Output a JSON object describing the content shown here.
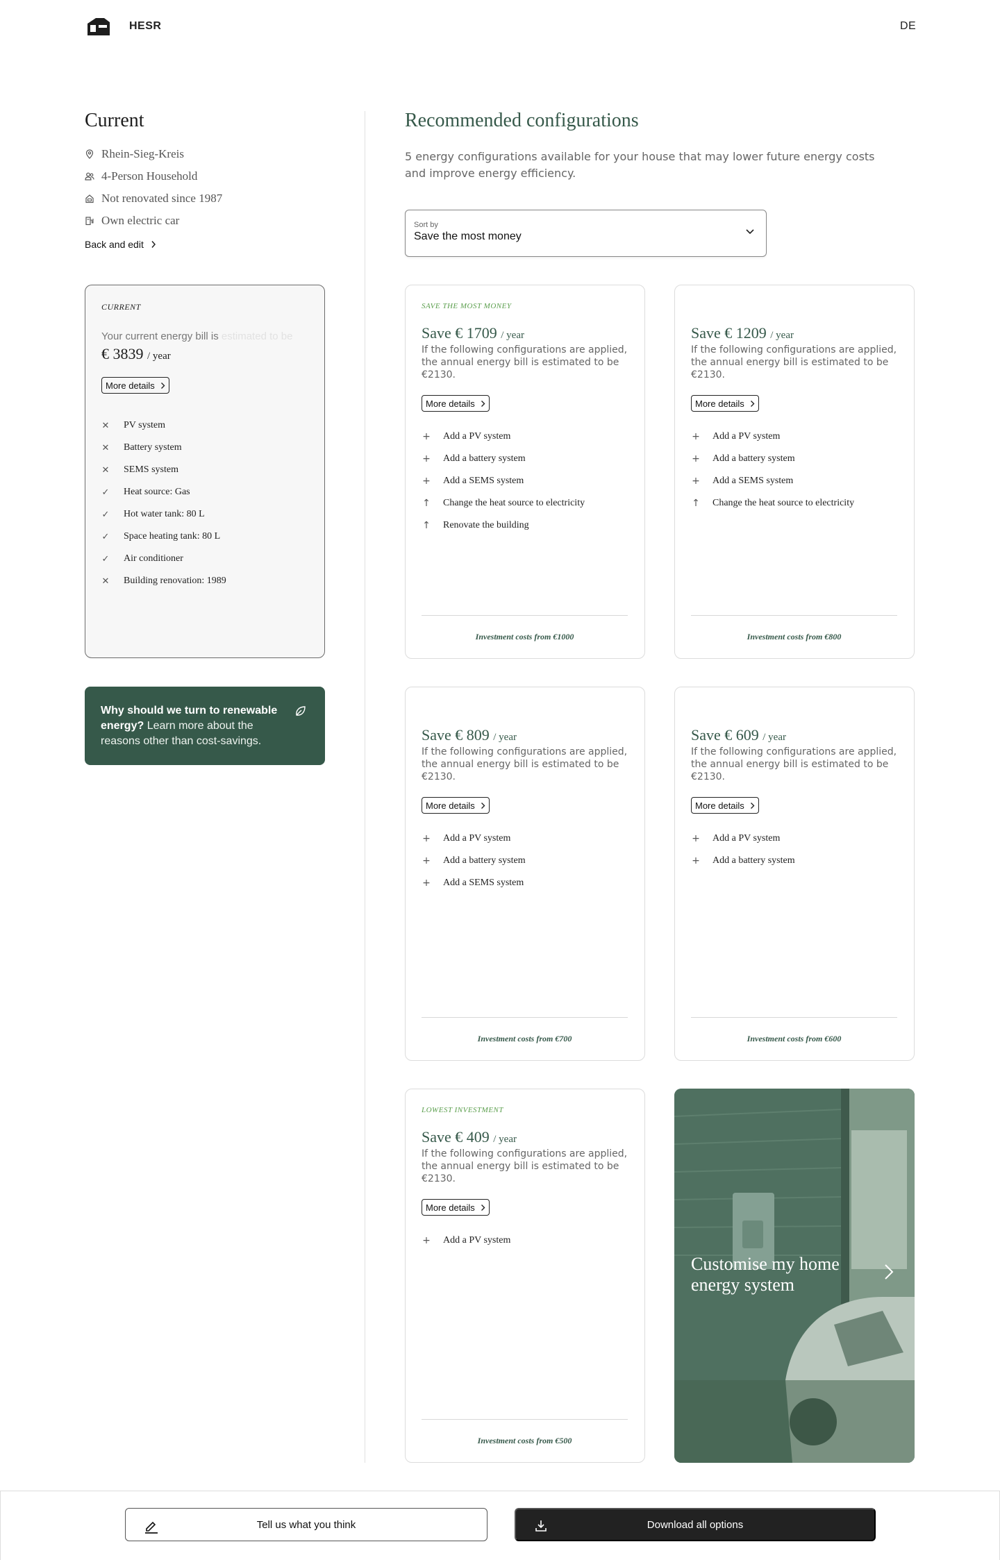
{
  "header": {
    "brand": "HESR",
    "language": "DE"
  },
  "current": {
    "title": "Current",
    "facts": [
      {
        "icon": "location-pin-icon",
        "text": "Rhein-Sieg-Kreis"
      },
      {
        "icon": "people-icon",
        "text": "4-Person Household"
      },
      {
        "icon": "house-icon",
        "text": "Not renovated since 1987"
      },
      {
        "icon": "ev-charger-icon",
        "text": "Own electric car"
      }
    ],
    "back_edit_label": "Back and edit",
    "card": {
      "tagline": "CURRENT",
      "bill_label": "Your current energy bill is",
      "bill_label_faded": "estimated to be",
      "bill_amount": "€ 3839",
      "bill_unit": "/ year",
      "more_details_label": "More details",
      "items": [
        {
          "status": "absent",
          "text": "PV system"
        },
        {
          "status": "absent",
          "text": "Battery system"
        },
        {
          "status": "absent",
          "text": "SEMS system"
        },
        {
          "status": "present",
          "text": "Heat source: Gas"
        },
        {
          "status": "present",
          "text": "Hot water tank: 80 L"
        },
        {
          "status": "present",
          "text": "Space heating tank: 80 L"
        },
        {
          "status": "present",
          "text": "Air conditioner"
        },
        {
          "status": "absent",
          "text": "Building renovation: 1989"
        }
      ]
    },
    "why": {
      "bold": "Why should we turn to renewable energy?",
      "rest": " Learn more about the reasons other than cost-savings.",
      "icon": "leaf-icon"
    }
  },
  "recommended": {
    "title": "Recommended configurations",
    "description": "5 energy configurations available for your house that may lower future energy costs and improve energy efficiency.",
    "sort": {
      "label": "Sort by",
      "value": "Save the most money"
    },
    "cards": [
      {
        "tagline": "SAVE THE MOST MONEY",
        "save": "Save € 1709",
        "unit": "/ year",
        "estimate": "If the following configurations are applied, the annual energy bill is estimated to be €2130.",
        "more_details_label": "More details",
        "items": [
          {
            "kind": "add",
            "text": "Add a PV system"
          },
          {
            "kind": "add",
            "text": "Add a battery system"
          },
          {
            "kind": "add",
            "text": "Add a SEMS system"
          },
          {
            "kind": "upgrade",
            "text": "Change the heat source to electricity"
          },
          {
            "kind": "upgrade",
            "text": "Renovate the building"
          }
        ],
        "investment": "Investment costs from €1000"
      },
      {
        "tagline": "",
        "save": "Save € 1209",
        "unit": "/ year",
        "estimate": "If the following configurations are applied, the annual energy bill is estimated to be €2130.",
        "more_details_label": "More details",
        "items": [
          {
            "kind": "add",
            "text": "Add a PV system"
          },
          {
            "kind": "add",
            "text": "Add a battery system"
          },
          {
            "kind": "add",
            "text": "Add a SEMS system"
          },
          {
            "kind": "upgrade",
            "text": "Change the heat source to electricity"
          }
        ],
        "investment": "Investment costs from €800"
      },
      {
        "tagline": "",
        "save": "Save € 809",
        "unit": "/ year",
        "estimate": "If the following configurations are applied, the annual energy bill is estimated to be €2130.",
        "more_details_label": "More details",
        "items": [
          {
            "kind": "add",
            "text": "Add a PV system"
          },
          {
            "kind": "add",
            "text": "Add a battery system"
          },
          {
            "kind": "add",
            "text": "Add a SEMS system"
          }
        ],
        "investment": "Investment costs from €700"
      },
      {
        "tagline": "",
        "save": "Save € 609",
        "unit": "/ year",
        "estimate": "If the following configurations are applied, the annual energy bill is estimated to be €2130.",
        "more_details_label": "More details",
        "items": [
          {
            "kind": "add",
            "text": "Add a PV system"
          },
          {
            "kind": "add",
            "text": "Add a battery system"
          }
        ],
        "investment": "Investment costs from €600"
      },
      {
        "tagline": "LOWEST INVESTMENT",
        "save": "Save € 409",
        "unit": "/ year",
        "estimate": "If the following configurations are applied, the annual energy bill is estimated to be €2130.",
        "more_details_label": "More details",
        "items": [
          {
            "kind": "add",
            "text": "Add a PV system"
          }
        ],
        "investment": "Investment costs from €500"
      }
    ],
    "customise": {
      "title": "Customise my home energy system"
    }
  },
  "bottom": {
    "feedback_label": "Tell us what you think",
    "download_label": "Download all options"
  },
  "colors": {
    "brand_green": "#36594a",
    "tag_green": "#5a9e4c",
    "dark_button": "#222222"
  }
}
